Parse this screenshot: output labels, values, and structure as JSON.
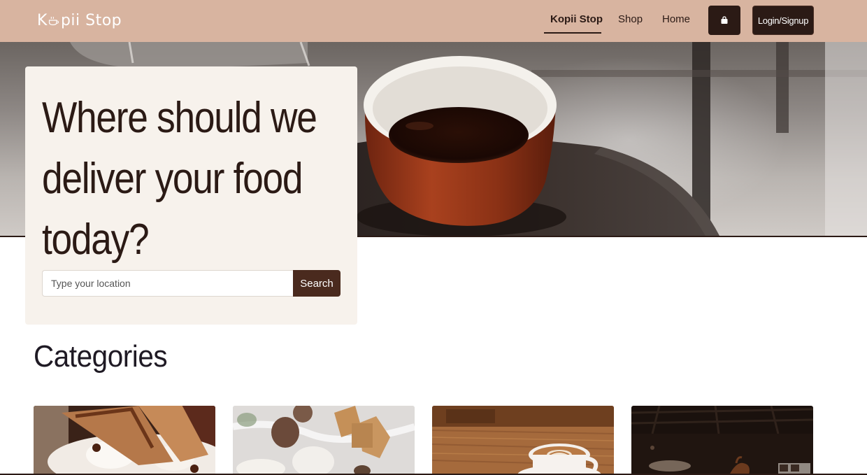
{
  "navbar": {
    "brand": "Kopii Stop",
    "brand_parts": {
      "first": "K",
      "rest": "pii Stop"
    },
    "links": [
      {
        "label": "Kopii Stop",
        "active": true
      },
      {
        "label": "Shop",
        "active": false
      },
      {
        "label": "Home",
        "active": false
      }
    ],
    "cart_icon": "shopping-bag-icon",
    "login_label": "Login/Signup"
  },
  "hero": {
    "headline": "Where should we deliver your food today?",
    "search": {
      "placeholder": "Type your location",
      "value": "",
      "button_label": "Search"
    }
  },
  "categories": {
    "title": "Categories",
    "items": [
      {
        "image": "dessert-with-biscotti"
      },
      {
        "image": "gingerbread-cookies-and-pinecones"
      },
      {
        "image": "latte-art-coffee-cup"
      },
      {
        "image": "dark-cafe-interior"
      }
    ]
  },
  "colors": {
    "navbar_bg": "#d8b4a0",
    "primary_dark": "#2b1a15",
    "button_brown": "#4a2a1e",
    "card_bg": "#f7f2ec"
  }
}
